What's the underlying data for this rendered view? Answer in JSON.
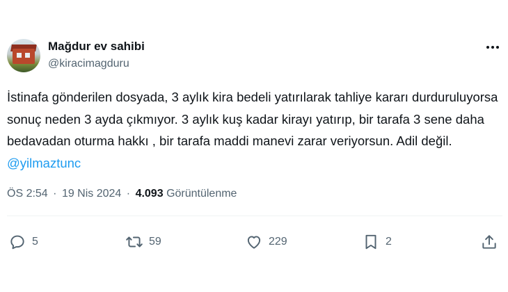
{
  "author": {
    "name": "Mağdur ev sahibi",
    "handle": "@kiracimagduru"
  },
  "tweet": {
    "text": "İstinafa gönderilen dosyada, 3 aylık kira bedeli yatırılarak tahliye kararı durduruluyorsa sonuç neden 3 ayda çıkmıyor. 3 aylık kuş kadar kirayı yatırıp, bir tarafa 3 sene daha bedavadan oturma hakkı , bir tarafa maddi manevi zarar veriyorsun. Adil değil.",
    "mention": "@yilmaztunc"
  },
  "meta": {
    "time": "ÖS 2:54",
    "separator": "·",
    "date": "19 Nis 2024",
    "views_count": "4.093",
    "views_label": "Görüntülenme"
  },
  "actions": {
    "replies": "5",
    "retweets": "59",
    "likes": "229",
    "bookmarks": "2"
  },
  "icons": {
    "more": "more-horizontal-icon",
    "reply": "reply-bubble-icon",
    "retweet": "retweet-icon",
    "like": "heart-icon",
    "bookmark": "bookmark-icon",
    "share": "share-upload-icon"
  },
  "colors": {
    "text": "#0f1419",
    "secondary": "#536471",
    "link": "#1d9bf0"
  }
}
